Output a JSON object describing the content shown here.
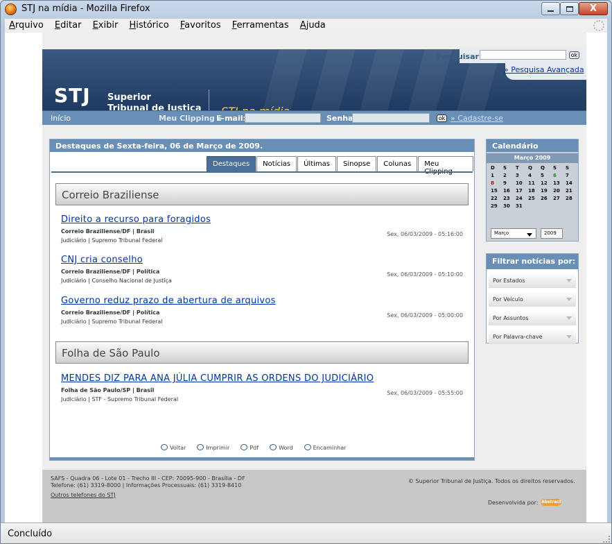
{
  "window": {
    "title": "STJ na mídia - Mozilla Firefox",
    "close_label": "X"
  },
  "menu": [
    "Arquivo",
    "Editar",
    "Exibir",
    "Histórico",
    "Favoritos",
    "Ferramentas",
    "Ajuda"
  ],
  "header": {
    "search_label": "Pesquisar:",
    "search_button": "ok",
    "advanced_search": "» Pesquisa Avançada",
    "logo_abbr": "STJ",
    "logo_line1": "Superior",
    "logo_line2": "Tribunal de Justiça",
    "logo_tagline": "STJ na mídia"
  },
  "nav": {
    "home": "Início",
    "clipping": "Meu Clipping »",
    "email_label": "E-mail:",
    "password_label": "Senha:",
    "go_button": "ok",
    "register": "» Cadastre-se"
  },
  "main": {
    "heading": "Destaques de Sexta-feira, 06 de Março de 2009.",
    "tabs": [
      "Destaques",
      "Notícias",
      "Últimas",
      "Sinopse",
      "Colunas",
      "Meu Clipping"
    ],
    "active_tab": "Destaques",
    "sources": [
      {
        "name": "Correio Braziliense",
        "items": [
          {
            "title": "Direito a recurso para foragidos",
            "source": "Correio Braziliense/DF | Brasil",
            "category": "Judiciário | Supremo Tribunal Federal",
            "date": "Sex, 06/03/2009 - 05:16:00"
          },
          {
            "title": "CNJ cria conselho",
            "source": "Correio Braziliense/DF | Política",
            "category": "Judiciário | Conselho Nacional de Justiça",
            "date": "Sex, 06/03/2009 - 05:10:00"
          },
          {
            "title": "Governo reduz prazo de abertura de arquivos",
            "source": "Correio Braziliense/DF | Política",
            "category": "Judiciário | Supremo Tribunal Federal",
            "date": "Sex, 06/03/2009 - 05:00:00"
          }
        ]
      },
      {
        "name": "Folha de São Paulo",
        "items": [
          {
            "title": "MENDES DIZ PARA ANA JÚLIA CUMPRIR AS ORDENS DO JUDICIÁRIO",
            "source": "Folha de São Paulo/SP | Brasil",
            "category": "Judiciário | STF - Supremo Tribunal Federal",
            "date": "Sex, 06/03/2009 - 05:55:00"
          }
        ]
      }
    ],
    "actions": [
      "Voltar",
      "Imprimir",
      "Pdf",
      "Word",
      "Encaminhar"
    ]
  },
  "calendar": {
    "heading": "Calendário",
    "month_title": "Março 2009",
    "weekdays": [
      "D",
      "S",
      "T",
      "Q",
      "Q",
      "S",
      "S"
    ],
    "weeks": [
      [
        "1",
        "2",
        "3",
        "4",
        "5",
        "6",
        "7"
      ],
      [
        "8",
        "9",
        "10",
        "11",
        "12",
        "13",
        "14"
      ],
      [
        "15",
        "16",
        "17",
        "18",
        "19",
        "20",
        "21"
      ],
      [
        "22",
        "23",
        "24",
        "25",
        "26",
        "27",
        "28"
      ],
      [
        "29",
        "30",
        "31",
        "",
        "",
        "",
        ""
      ]
    ],
    "highlight_today": "6",
    "highlight_sunday": "8",
    "month_select": "Março",
    "year_input": "2009"
  },
  "filter": {
    "heading": "Filtrar notícias por:",
    "options": [
      "Por Estados",
      "Por Veículo",
      "Por Assuntos",
      "Por Palavra-chave"
    ]
  },
  "footer": {
    "address": "SAFS - Quadra 06 - Lote 01 - Trecho III - CEP: 70095-900 - Brasília - DF",
    "phones": "Telefone: (61) 3319-8000 | Informações Processuais: (61) 3319-8410",
    "other_phones": "Outros telefones do STJ",
    "copyright": "© Superior Tribunal de Justiça. Todos os direitos reservados.",
    "developed_by": "Desenvolvida por:",
    "dev_logo": "Abstract"
  },
  "status": {
    "text": "Concluído"
  },
  "colors": {
    "header_blue": "#2a4a72",
    "nav_blue": "#6a8fb7",
    "tagline_yellow": "#f2d23a",
    "link_blue": "#0033aa"
  }
}
